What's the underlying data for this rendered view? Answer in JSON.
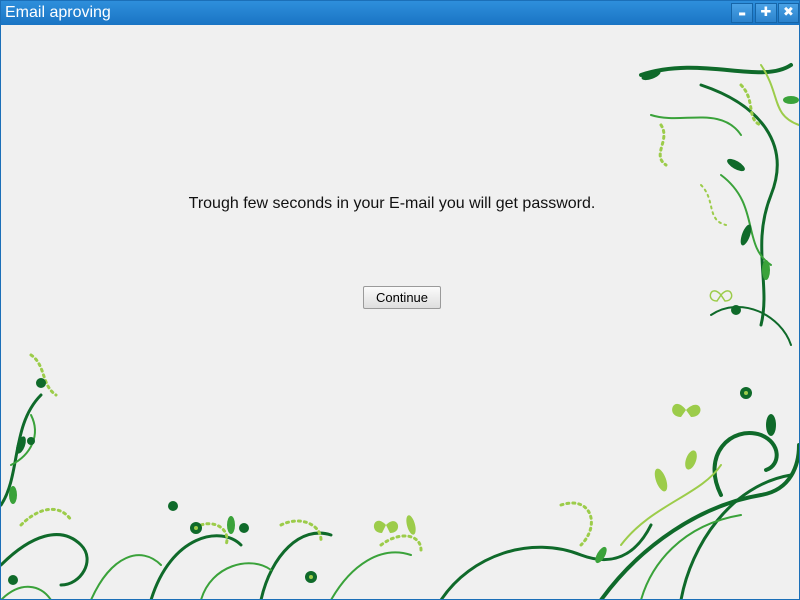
{
  "window": {
    "title": "Email aproving",
    "controls": {
      "minimize": "▬",
      "maximize": "✚",
      "close": "✖"
    }
  },
  "main": {
    "message": "Trough few seconds in your E-mail you will get password.",
    "continue_label": "Continue"
  },
  "colors": {
    "titlebar": "#1a74c4",
    "background": "#f0f0f0",
    "vine_dark": "#0f6a2a",
    "vine_mid": "#3aa23a",
    "vine_light": "#9ccc4a"
  }
}
